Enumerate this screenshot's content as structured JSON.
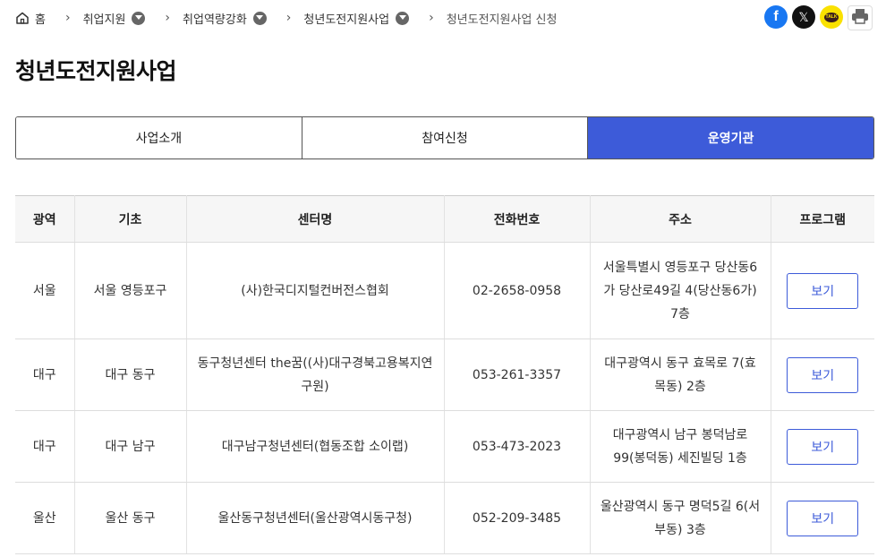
{
  "breadcrumb": {
    "home": "홈",
    "items": [
      {
        "label": "취업지원"
      },
      {
        "label": "취업역량강화"
      },
      {
        "label": "청년도전지원사업"
      }
    ],
    "current": "청년도전지원사업 신청"
  },
  "share": {
    "facebook": "f",
    "x": "𝕏",
    "kakao": "TALK"
  },
  "page": {
    "title": "청년도전지원사업"
  },
  "tabs": [
    {
      "label": "사업소개",
      "active": false
    },
    {
      "label": "참여신청",
      "active": false
    },
    {
      "label": "운영기관",
      "active": true
    }
  ],
  "table": {
    "headers": [
      "광역",
      "기초",
      "센터명",
      "전화번호",
      "주소",
      "프로그램"
    ],
    "rows": [
      {
        "region": "서울",
        "district": "서울 영등포구",
        "center": "(사)한국디지털컨버전스협회",
        "phone": "02-2658-0958",
        "address": "서울특별시 영등포구 당산동6가 당산로49길 4(당산동6가) 7층",
        "program": "보기"
      },
      {
        "region": "대구",
        "district": "대구 동구",
        "center": "동구청년센터 the꿈((사)대구경북고용복지연구원)",
        "phone": "053-261-3357",
        "address": "대구광역시 동구 효목로 7(효목동) 2층",
        "program": "보기"
      },
      {
        "region": "대구",
        "district": "대구 남구",
        "center": "대구남구청년센터(협동조합 소이랩)",
        "phone": "053-473-2023",
        "address": "대구광역시 남구 봉덕남로 99(봉덕동) 세진빌딩 1층",
        "program": "보기"
      },
      {
        "region": "울산",
        "district": "울산 동구",
        "center": "울산동구청년센터(울산광역시동구청)",
        "phone": "052-209-3485",
        "address": "울산광역시 동구 명덕5길 6(서부동) 3층",
        "program": "보기"
      }
    ]
  },
  "colors": {
    "accent": "#3d5bd9",
    "facebook": "#1877f2",
    "kakao": "#fae100"
  }
}
